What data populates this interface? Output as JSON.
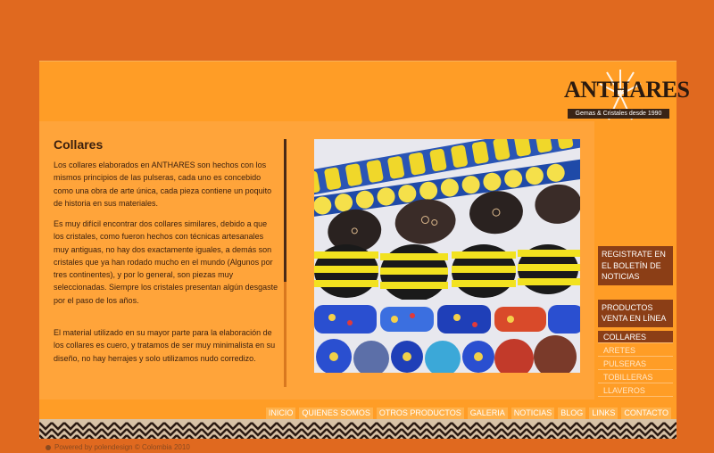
{
  "logo": {
    "name": "ANTHARES",
    "tagline": "Gemas & Cristales desde 1990"
  },
  "article": {
    "title": "Collares",
    "paragraphs": [
      "Los collares elaborados en ANTHARES son hechos con los mismos principios de las pulseras, cada uno es concebido como una obra de arte única, cada pieza contiene un poquito de historia en sus materiales.",
      "Es muy difícil encontrar dos collares similares, debido a que los cristales, como fueron hechos con técnicas artesanales muy antiguas, no hay dos exactamente iguales, a demás son cristales que ya han rodado mucho en el mundo (Algunos por tres continentes), y por lo general, son piezas muy seleccionadas. Siempre los cristales presentan algún desgaste por el paso de los años.",
      "El material utilizado en su mayor parte para la elaboración de los collares es cuero, y tratamos de ser muy minimalista en su diseño, no hay herrajes y solo utilizamos nudo corredizo."
    ]
  },
  "side": {
    "register": "REGISTRATE EN EL BOLETÍN DE NOTICIAS",
    "products": "PRODUCTOS VENTA EN LÍNEA",
    "items": [
      "COLLARES",
      "ARETES",
      "PULSERAS",
      "TOBILLERAS",
      "LLAVEROS"
    ]
  },
  "nav": [
    "INICIO",
    "QUIENES SOMOS",
    "OTROS PRODUCTOS",
    "GALERIA",
    "NOTICIAS",
    "BLOG",
    "LINKS",
    "CONTACTO"
  ],
  "footer": {
    "text": "Powered by polendesign © Colombia 2010"
  },
  "colors": {
    "page_bg": "#e0691f",
    "panel": "#ffa43a",
    "accent_dark": "#8b3e16"
  }
}
